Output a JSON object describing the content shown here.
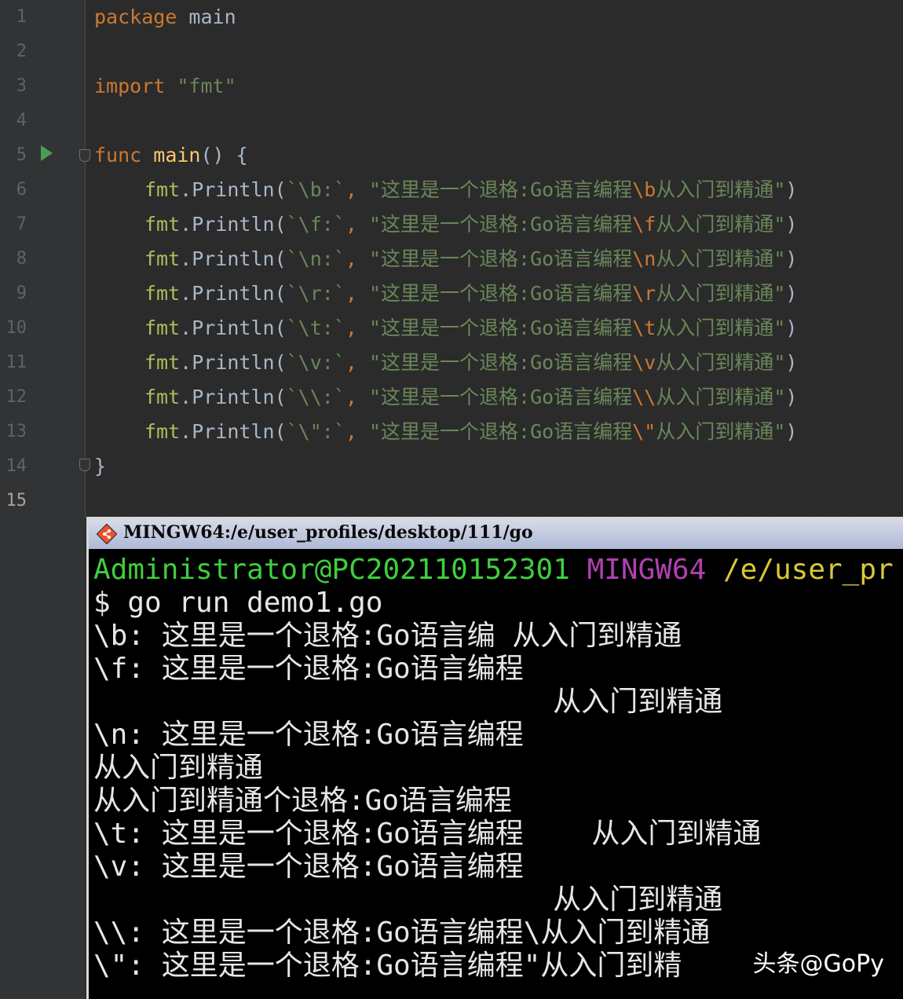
{
  "editor": {
    "line_numbers": [
      "1",
      "2",
      "3",
      "4",
      "5",
      "6",
      "7",
      "8",
      "9",
      "10",
      "11",
      "12",
      "13",
      "14",
      "15"
    ],
    "code": {
      "l1": {
        "kw": "package",
        "rest": " main"
      },
      "l3": {
        "kw": "import",
        "str": " \"fmt\""
      },
      "l5": {
        "kw": "func",
        "fn": " main",
        "rest": "() {"
      },
      "println": [
        {
          "pkg": "fmt",
          "call": ".Println(",
          "tick": "`\\b:`",
          ",": ", ",
          "s1": "\"这里是一个退格:Go语言编程",
          "esc": "\\b",
          "s2": "从入门到精通\"",
          "close": ")"
        },
        {
          "pkg": "fmt",
          "call": ".Println(",
          "tick": "`\\f:`",
          ",": ", ",
          "s1": "\"这里是一个退格:Go语言编程",
          "esc": "\\f",
          "s2": "从入门到精通\"",
          "close": ")"
        },
        {
          "pkg": "fmt",
          "call": ".Println(",
          "tick": "`\\n:`",
          ",": ", ",
          "s1": "\"这里是一个退格:Go语言编程",
          "esc": "\\n",
          "s2": "从入门到精通\"",
          "close": ")"
        },
        {
          "pkg": "fmt",
          "call": ".Println(",
          "tick": "`\\r:`",
          ",": ", ",
          "s1": "\"这里是一个退格:Go语言编程",
          "esc": "\\r",
          "s2": "从入门到精通\"",
          "close": ")"
        },
        {
          "pkg": "fmt",
          "call": ".Println(",
          "tick": "`\\t:`",
          ",": ", ",
          "s1": "\"这里是一个退格:Go语言编程",
          "esc": "\\t",
          "s2": "从入门到精通\"",
          "close": ")"
        },
        {
          "pkg": "fmt",
          "call": ".Println(",
          "tick": "`\\v:`",
          ",": ", ",
          "s1": "\"这里是一个退格:Go语言编程",
          "esc": "\\v",
          "s2": "从入门到精通\"",
          "close": ")"
        },
        {
          "pkg": "fmt",
          "call": ".Println(",
          "tick": "`\\\\:`",
          ",": ", ",
          "s1": "\"这里是一个退格:Go语言编程",
          "esc": "\\\\",
          "s2": "从入门到精通\"",
          "close": ")"
        },
        {
          "pkg": "fmt",
          "call": ".Println(",
          "tick": "`\\\":`",
          ",": ", ",
          "s1": "\"这里是一个退格:Go语言编程",
          "esc": "\\\"",
          "s2": "从入门到精通\"",
          "close": ")"
        }
      ],
      "l14": "}"
    }
  },
  "terminal": {
    "title": "MINGW64:/e/user_profiles/desktop/111/go",
    "prompt_user": "Administrator@PC202110152301",
    "prompt_env": "MINGW64",
    "prompt_path": "/e/user_pr",
    "command": "$ go run demo1.go",
    "output": [
      "\\b: 这里是一个退格:Go语言编 从入门到精通",
      "\\f: 这里是一个退格:Go语言编程",
      "                           从入门到精通",
      "\\n: 这里是一个退格:Go语言编程",
      "从入门到精通",
      "从入门到精通个退格:Go语言编程",
      "\\t: 这里是一个退格:Go语言编程    从入门到精通",
      "\\v: 这里是一个退格:Go语言编程",
      "                           从入门到精通",
      "\\\\: 这里是一个退格:Go语言编程\\从入门到精通",
      "\\\": 这里是一个退格:Go语言编程\"从入门到精"
    ],
    "watermark": "头条@GoPy"
  }
}
